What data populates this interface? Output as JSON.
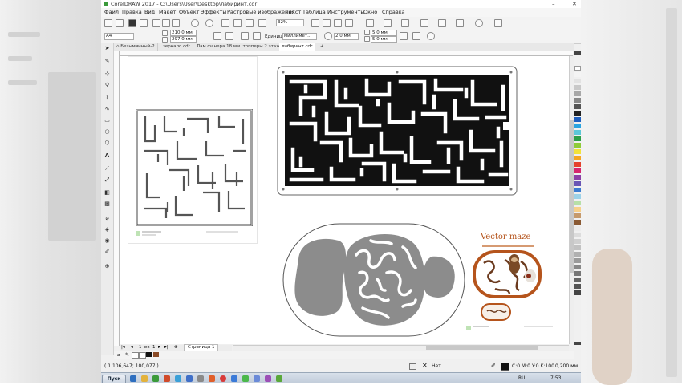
{
  "window": {
    "title": "CorelDRAW 2017 - C:\\Users\\User\\Desktop\\лабиринт.cdr"
  },
  "menu": [
    "Файл",
    "Правка",
    "Вид",
    "Макет",
    "Объект",
    "Эффекты",
    "Растровые изображения",
    "Текст",
    "Таблица",
    "Инструменты",
    "Окно",
    "Справка"
  ],
  "toolbar": {
    "zoom": "32%",
    "page_size": "A4",
    "width": "210,0 мм",
    "height": "297,0 мм",
    "units_label": "Единицы:",
    "units": "миллимет...",
    "nudge": "2,0 мм",
    "dup_x": "5,0 мм",
    "dup_y": "5,0 мм"
  },
  "tabs": [
    "Безымянный-2",
    "зеркало.cdr",
    "Лам фанера 18 мм. топперы 2 этаж.cdr",
    "лабиринт.cdr"
  ],
  "canvas": {
    "poster_title": "Vector maze"
  },
  "pages": {
    "current": "1",
    "of_label": "из",
    "total": "1",
    "tab": "Страница 1"
  },
  "status": {
    "coords": "( 1 106,647; 100,077 )",
    "outline_none": "Нет",
    "color": "C:0 M:0 Y:0 K:100",
    "outline_width": "0,200 мм"
  },
  "taskbar": {
    "start": "Пуск",
    "lang": "RU",
    "time": "7:53"
  },
  "colors": {
    "maze_fill": "#111111",
    "blob_fill": "#8c8c8c",
    "poster_accent": "#b5541c"
  }
}
